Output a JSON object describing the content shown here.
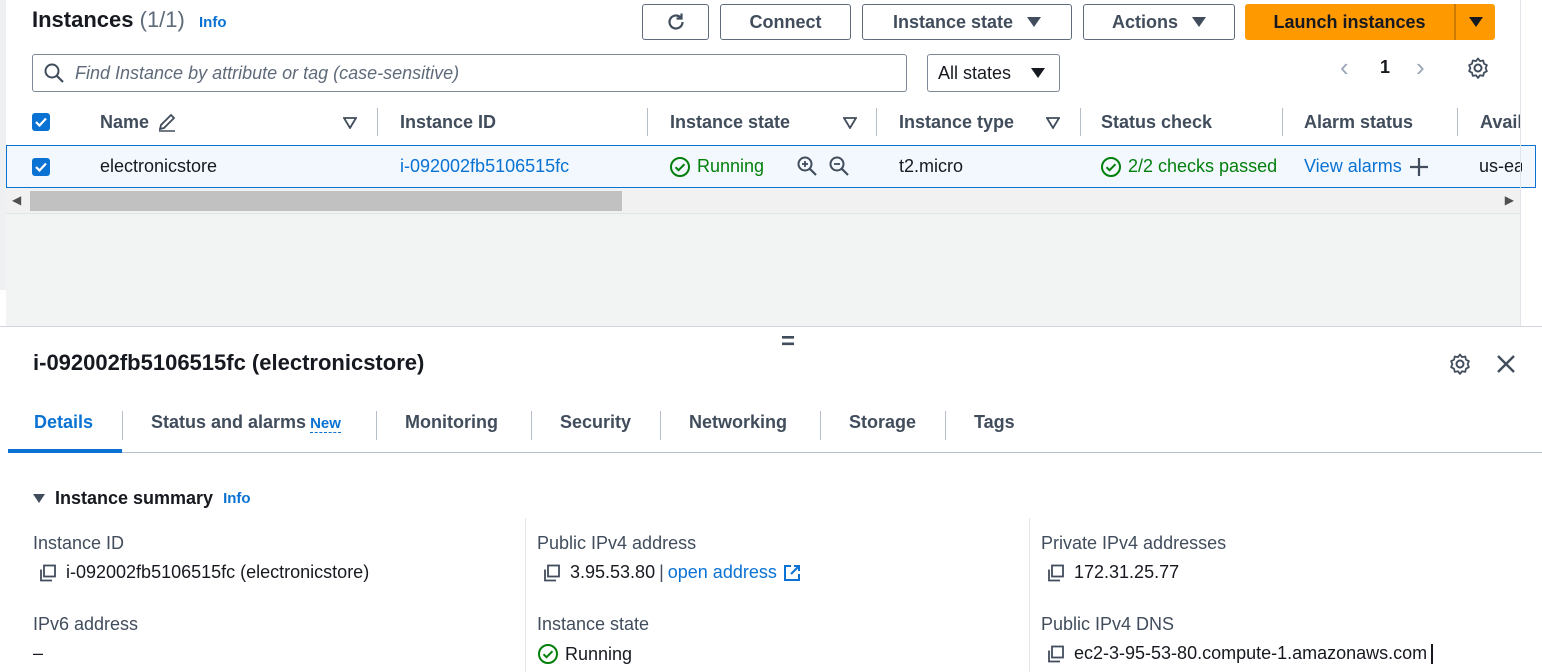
{
  "header": {
    "title": "Instances",
    "count": "(1/1)",
    "info": "Info",
    "connect_label": "Connect",
    "instance_state_label": "Instance state",
    "actions_label": "Actions",
    "launch_label": "Launch instances",
    "search_placeholder": "Find Instance by attribute or tag (case-sensitive)",
    "state_filter": "All states",
    "page": "1"
  },
  "table": {
    "columns": [
      "Name",
      "Instance ID",
      "Instance state",
      "Instance type",
      "Status check",
      "Alarm status",
      "Avail"
    ],
    "row": {
      "name": "electronicstore",
      "instance_id": "i-092002fb5106515fc",
      "state": "Running",
      "type": "t2.micro",
      "status_check": "2/2 checks passed",
      "alarm": "View alarms",
      "avail": "us-ea"
    }
  },
  "details": {
    "handle": "=",
    "title": "i-092002fb5106515fc (electronicstore)",
    "tabs": [
      "Details",
      "Status and alarms",
      "Monitoring",
      "Security",
      "Networking",
      "Storage",
      "Tags"
    ],
    "new_badge": "New",
    "summary_title": "Instance summary",
    "summary_info": "Info",
    "fields": {
      "instance_id_label": "Instance ID",
      "instance_id_value": "i-092002fb5106515fc (electronicstore)",
      "ipv6_label": "IPv6 address",
      "ipv6_value": "–",
      "public_ipv4_label": "Public IPv4 address",
      "public_ipv4_value": "3.95.53.80",
      "public_ipv4_sep": "|",
      "open_address": "open address",
      "state_label": "Instance state",
      "state_value": "Running",
      "private_ipv4_label": "Private IPv4 addresses",
      "private_ipv4_value": "172.31.25.77",
      "public_dns_label": "Public IPv4 DNS",
      "public_dns_value": "ec2-3-95-53-80.compute-1.amazonaws.com"
    }
  },
  "colors": {
    "accent": "#0972d3",
    "launch": "#ff9900",
    "success": "#037f0c"
  }
}
